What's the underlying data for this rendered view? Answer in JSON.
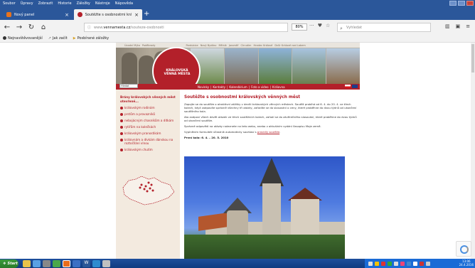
{
  "menu": [
    "Soubor",
    "Úpravy",
    "Zobrazit",
    "Historie",
    "Záložky",
    "Nástroje",
    "Nápověda"
  ],
  "tabs": [
    {
      "label": "Nový panel"
    },
    {
      "label": "Soutěžte s osobnostmi královských v..."
    }
  ],
  "address": {
    "prefix": "www.",
    "domain": "vennamesta.cz",
    "path": "/souteze-osobnosti",
    "zoom": "80%"
  },
  "search": {
    "placeholder": "Vyhledat"
  },
  "bookmarks": [
    "Nejnavštěvovanější",
    "Jak začít",
    "Posbírané záložky"
  ],
  "site": {
    "top_links": [
      "Úvodní Mýto",
      "Poděbrady",
      "Pardubice",
      "Nový Bydžov",
      "Mělník",
      "Jaroměř",
      "Chrudim",
      "Hradec Králové",
      "Dvůr Králové nad Labem"
    ],
    "logo_line1": "KRÁLOVSKÁ",
    "logo_line2": "VĚNNÁ MĚSTA",
    "nav": [
      "Novinky",
      "Kontakty",
      "Kalendárium",
      "Foto a video",
      "Královna"
    ],
    "search_value": "Hledat",
    "left_heading": "Brány královských věnných měst otevřené...",
    "left_items": [
      "královským rodinám",
      "prstům a provazníků",
      "nebojácným chasníkům a dítkám",
      "rytířům na kolečkách",
      "královským pranostikám",
      "královnám a dívkám dánskou na roztočílání vlnou",
      "královským chutím"
    ],
    "title": "Soutěžte s osobnostmi královských věnných měst",
    "p1": "Zapojte se do soutěže o atraktivní zážitky v devíti královských věnných městech. Soutěž probíhá od 6. 4. do 20. 4. ve třech kolech, když zodpovíte správně všechny tři otázky, zařadíte se do slosování o ceny, které proběhne do dvou týdnů od ukončení soutěžního kola.",
    "p2": "Ato zodpoví všech devět otázek ve třech soutěžních kolech, zařadí se do závěrečného slosování, které proběhne do dvou týdnů od ukončení soutěže.",
    "p3": "Správné odpovědi na otázky naleznete na teto webu, anebo v aktuálním vydání časopisu Moje země.",
    "p4_prefix": "Vyplněním formuláře účastník automaticky souhlasí s",
    "p4_link": "pravidly soutěže",
    "p5": "První kolo: 6. 4. – 20. 5. 2010",
    "facebook": "f"
  },
  "taskbar": {
    "start": "Start",
    "clock_time": "13:06",
    "clock_date": "24.4.2016"
  }
}
